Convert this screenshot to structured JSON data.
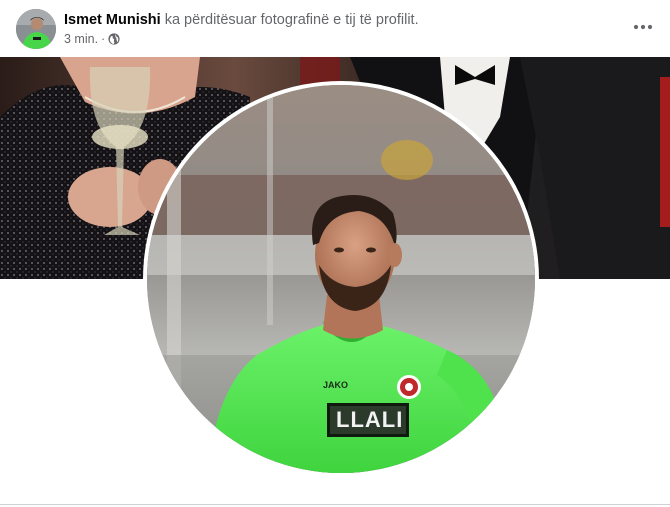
{
  "post": {
    "author_name": "Ismet Munishi",
    "action_text": "ka përditësuar fotografinë e tij të profilit.",
    "timestamp": "3 min.",
    "separator": "·",
    "privacy_icon": "globe-icon",
    "more_icon": "more-options-icon"
  },
  "images": {
    "cover": "cover-photo",
    "profile": "profile-photo"
  },
  "profile_jersey": {
    "brand_text": "JAKO",
    "sponsor_text": "LLALI"
  }
}
